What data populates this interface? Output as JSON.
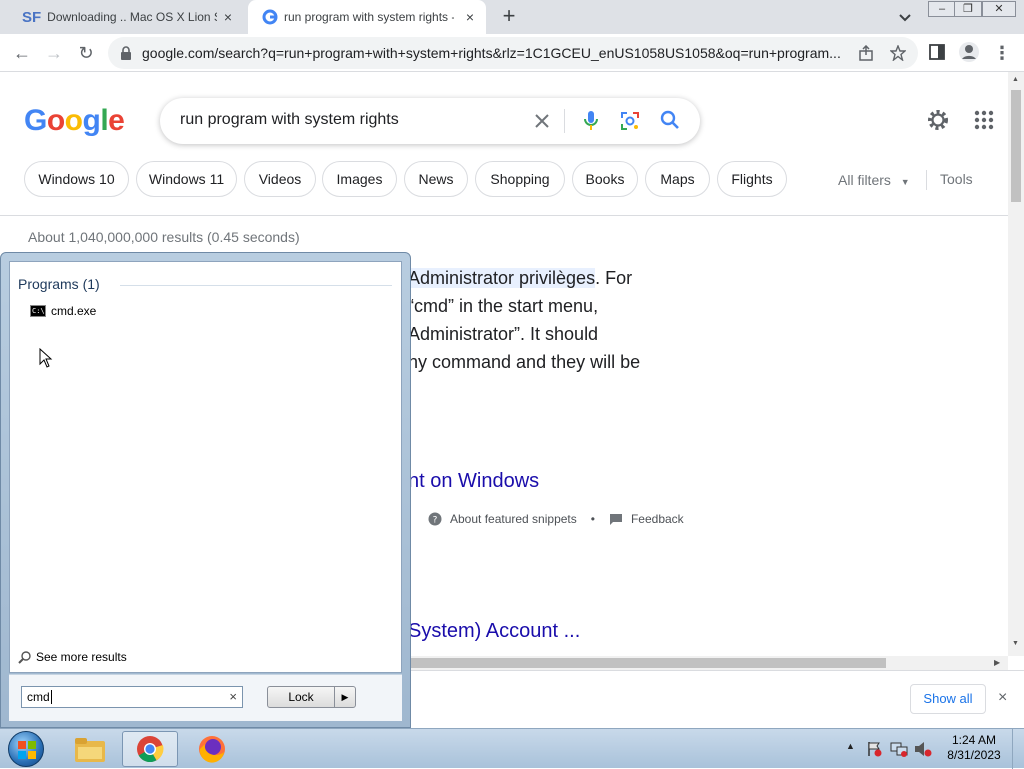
{
  "browser": {
    "tabs": [
      {
        "favicon": "SF",
        "title": "Downloading .. Mac OS X Lion Sk",
        "close": "×"
      },
      {
        "favicon": "google-icon",
        "title": "run program with system rights -",
        "close": "×"
      }
    ],
    "new_tab": "+",
    "url": "google.com/search?q=run+program+with+system+rights&rlz=1C1GCEU_enUS1058US1058&oq=run+program..."
  },
  "google": {
    "query": "run program with system rights",
    "chips": [
      "Windows 10",
      "Windows 11",
      "Videos",
      "Images",
      "News",
      "Shopping",
      "Books",
      "Maps",
      "Flights"
    ],
    "all_filters": "All filters",
    "tools": "Tools",
    "result_stats": "About 1,040,000,000 results (0.45 seconds)",
    "snippet_lines": [
      {
        "highlight": "Administrator privilèges",
        "rest": ". For"
      },
      {
        "highlight": "",
        "rest": "“cmd” in the start menu,"
      },
      {
        "highlight": "",
        "rest": "Administrator”. It should"
      },
      {
        "highlight": "",
        "rest": "ny command and they will be"
      }
    ],
    "link_title_1": "nt on Windows",
    "about_snippets": "About featured snippets",
    "bullet": "•",
    "feedback": "Feedback",
    "link_title_2": "System) Account ..."
  },
  "downloads": {
    "show_all": "Show all",
    "close": "×"
  },
  "start_menu": {
    "programs_header": "Programs (1)",
    "program_item": "cmd.exe",
    "see_more": "See more results",
    "search_value": "cmd",
    "search_clear": "×",
    "lock_label": "Lock",
    "lock_arrow": "▶"
  },
  "taskbar": {
    "time": "1:24 AM",
    "date": "8/31/2023"
  }
}
